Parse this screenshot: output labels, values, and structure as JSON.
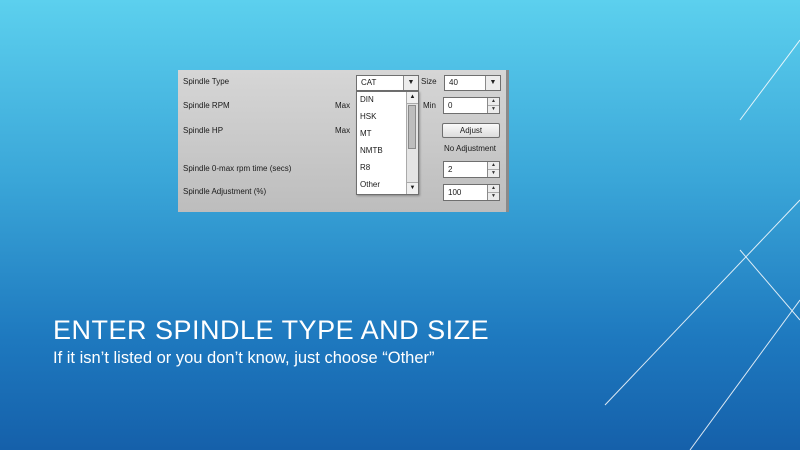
{
  "slide": {
    "title": "Enter Spindle Type and Size",
    "subtitle": "If it isn’t listed or you don’t know, just choose “Other”"
  },
  "screenshot": {
    "spindle_type": {
      "label": "Spindle Type",
      "selected": "CAT",
      "options": [
        "DIN",
        "HSK",
        "MT",
        "NMTB",
        "R8",
        "Other"
      ]
    },
    "size": {
      "label": "Size",
      "value": "40"
    },
    "spindle_rpm": {
      "label": "Spindle RPM",
      "max_label": "Max",
      "min_label": "Min",
      "min_value": "0"
    },
    "spindle_hp": {
      "label": "Spindle HP",
      "max_label": "Max",
      "adjust_button": "Adjust",
      "adjust_status": "No Adjustment"
    },
    "spindle_time": {
      "label": "Spindle 0-max rpm time (secs)",
      "value": "2"
    },
    "spindle_adjustment": {
      "label": "Spindle Adjustment (%)",
      "value": "100"
    }
  },
  "colors": {
    "background_top": "#5cd0ee",
    "background_bottom": "#1560aa",
    "text": "#ffffff"
  }
}
